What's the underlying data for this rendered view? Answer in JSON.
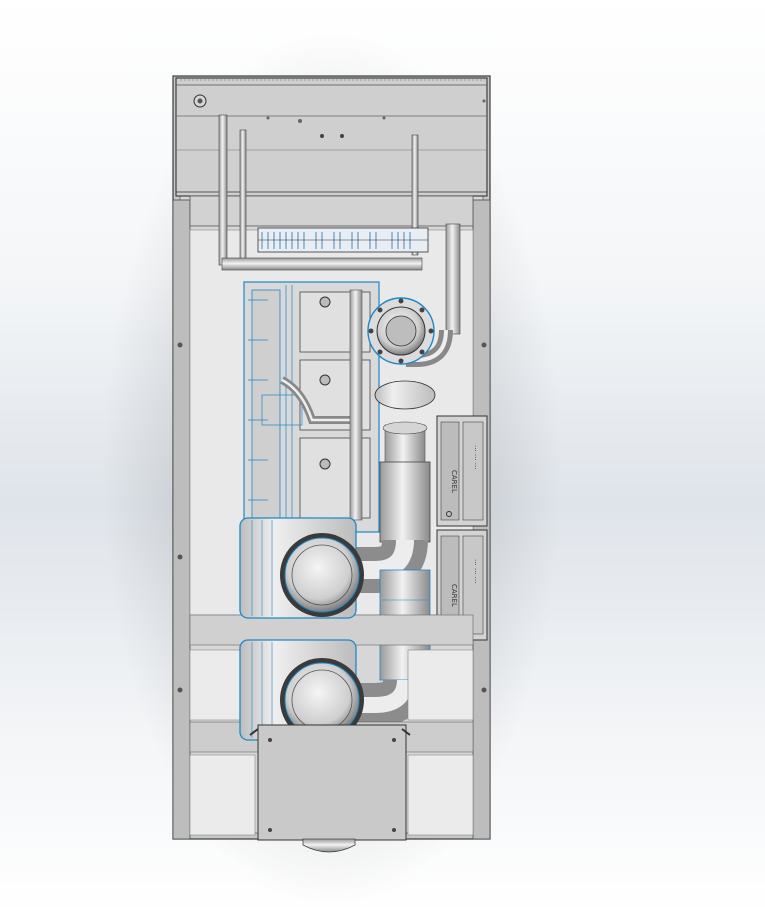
{
  "labels": {
    "panel_brand": "CAREL",
    "panel_sub": "···  ···  ···"
  },
  "colors": {
    "background_top": "#ffffff",
    "background_mid": "#dfe4ea",
    "metal_light": "#e4e4e4",
    "metal_mid": "#c9c9c9",
    "metal_dark": "#8d8d8d",
    "selection_highlight": "#1e88c8",
    "outline": "#3a3a3a"
  }
}
